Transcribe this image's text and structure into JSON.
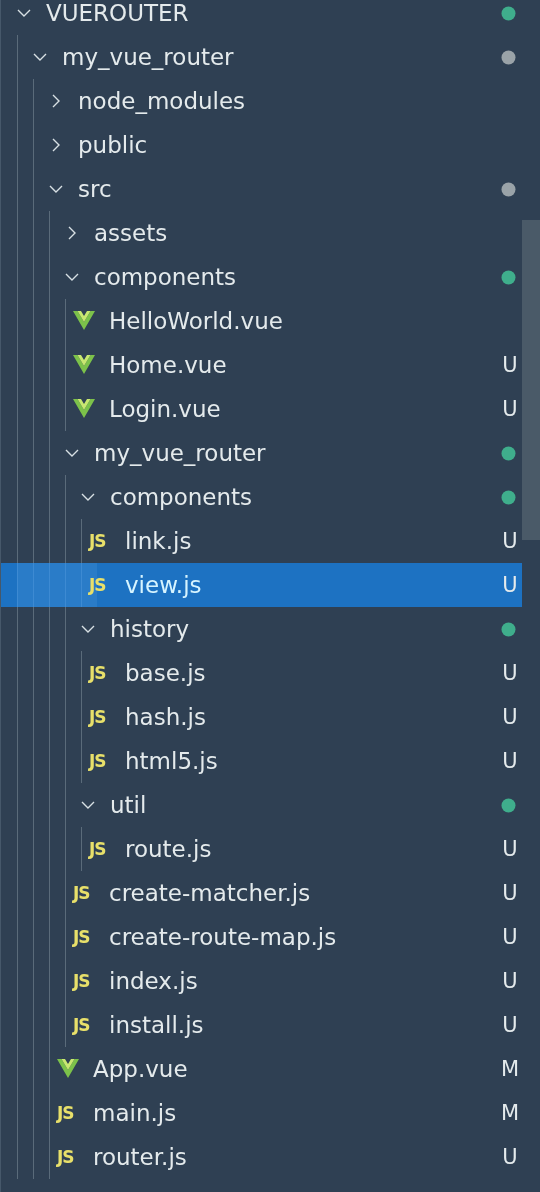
{
  "explorer": {
    "tree": [
      {
        "name": "VUEROUTER",
        "kind": "folder",
        "expanded": true,
        "selected": false,
        "color": "#3fae8c",
        "children": [
          {
            "name": "my_vue_router",
            "kind": "folder",
            "expanded": true,
            "selected": false,
            "color": "#9aa3a8",
            "children": [
              {
                "name": "node_modules",
                "kind": "folder",
                "expanded": false,
                "selected": false
              },
              {
                "name": "public",
                "kind": "folder",
                "expanded": false,
                "selected": false
              },
              {
                "name": "src",
                "kind": "folder",
                "expanded": true,
                "selected": false,
                "color": "#9aa3a8",
                "children": [
                  {
                    "name": "assets",
                    "kind": "folder",
                    "expanded": false,
                    "selected": false
                  },
                  {
                    "name": "components",
                    "kind": "folder",
                    "expanded": true,
                    "selected": false,
                    "color": "#3fae8c",
                    "children": [
                      {
                        "name": "HelloWorld.vue",
                        "kind": "vue",
                        "selected": false
                      },
                      {
                        "name": "Home.vue",
                        "kind": "vue",
                        "selected": false,
                        "status": "U"
                      },
                      {
                        "name": "Login.vue",
                        "kind": "vue",
                        "selected": false,
                        "status": "U"
                      }
                    ]
                  },
                  {
                    "name": "my_vue_router",
                    "kind": "folder",
                    "expanded": true,
                    "selected": false,
                    "color": "#3fae8c",
                    "children": [
                      {
                        "name": "components",
                        "kind": "folder",
                        "expanded": true,
                        "selected": false,
                        "color": "#3fae8c",
                        "children": [
                          {
                            "name": "link.js",
                            "kind": "js",
                            "badge": "JS",
                            "selected": false,
                            "status": "U"
                          },
                          {
                            "name": "view.js",
                            "kind": "js",
                            "badge": "JS",
                            "selected": true,
                            "status": "U"
                          }
                        ]
                      },
                      {
                        "name": "history",
                        "kind": "folder",
                        "expanded": true,
                        "selected": false,
                        "color": "#3fae8c",
                        "children": [
                          {
                            "name": "base.js",
                            "kind": "js",
                            "badge": "JS",
                            "selected": false,
                            "status": "U"
                          },
                          {
                            "name": "hash.js",
                            "kind": "js",
                            "badge": "JS",
                            "selected": false,
                            "status": "U"
                          },
                          {
                            "name": "html5.js",
                            "kind": "js",
                            "badge": "JS",
                            "selected": false,
                            "status": "U"
                          }
                        ]
                      },
                      {
                        "name": "util",
                        "kind": "folder",
                        "expanded": true,
                        "selected": false,
                        "color": "#3fae8c",
                        "children": [
                          {
                            "name": "route.js",
                            "kind": "js",
                            "badge": "JS",
                            "selected": false,
                            "status": "U"
                          }
                        ]
                      },
                      {
                        "name": "create-matcher.js",
                        "kind": "js",
                        "badge": "JS",
                        "selected": false,
                        "status": "U"
                      },
                      {
                        "name": "create-route-map.js",
                        "kind": "js",
                        "badge": "JS",
                        "selected": false,
                        "status": "U"
                      },
                      {
                        "name": "index.js",
                        "kind": "js",
                        "badge": "JS",
                        "selected": false,
                        "status": "U"
                      },
                      {
                        "name": "install.js",
                        "kind": "js",
                        "badge": "JS",
                        "selected": false,
                        "status": "U"
                      }
                    ]
                  },
                  {
                    "name": "App.vue",
                    "kind": "vue",
                    "selected": false,
                    "status": "M"
                  },
                  {
                    "name": "main.js",
                    "kind": "js",
                    "badge": "JS",
                    "selected": false,
                    "status": "M"
                  },
                  {
                    "name": "router.js",
                    "kind": "js",
                    "badge": "JS",
                    "selected": false,
                    "status": "U"
                  }
                ]
              }
            ]
          }
        ]
      }
    ]
  }
}
